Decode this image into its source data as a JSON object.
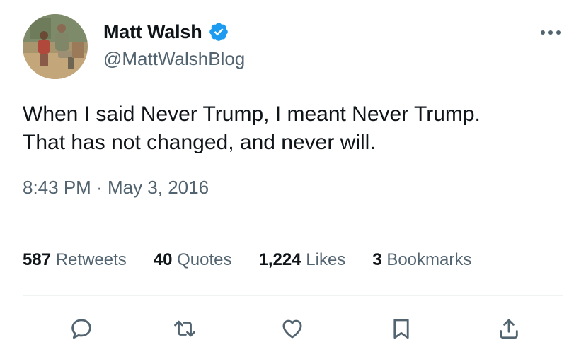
{
  "author": {
    "display_name": "Matt Walsh",
    "handle": "@MattWalshBlog",
    "verified": true,
    "accent_color": "#1d9bf0"
  },
  "tweet": {
    "text_lines": [
      "When I said Never Trump, I meant Never Trump.",
      "That has not changed, and never will."
    ],
    "time": "8:43 PM",
    "separator": "·",
    "date": "May 3, 2016"
  },
  "stats": [
    {
      "count": "587",
      "label": "Retweets"
    },
    {
      "count": "40",
      "label": "Quotes"
    },
    {
      "count": "1,224",
      "label": "Likes"
    },
    {
      "count": "3",
      "label": "Bookmarks"
    }
  ],
  "actions": [
    {
      "icon": "reply-icon"
    },
    {
      "icon": "retweet-icon"
    },
    {
      "icon": "like-heart-icon"
    },
    {
      "icon": "bookmark-icon"
    },
    {
      "icon": "share-icon"
    }
  ],
  "colors": {
    "primary_text": "#0f1419",
    "secondary_text": "#536471",
    "divider": "#eff3f4",
    "verified_badge": "#1d9bf0"
  }
}
